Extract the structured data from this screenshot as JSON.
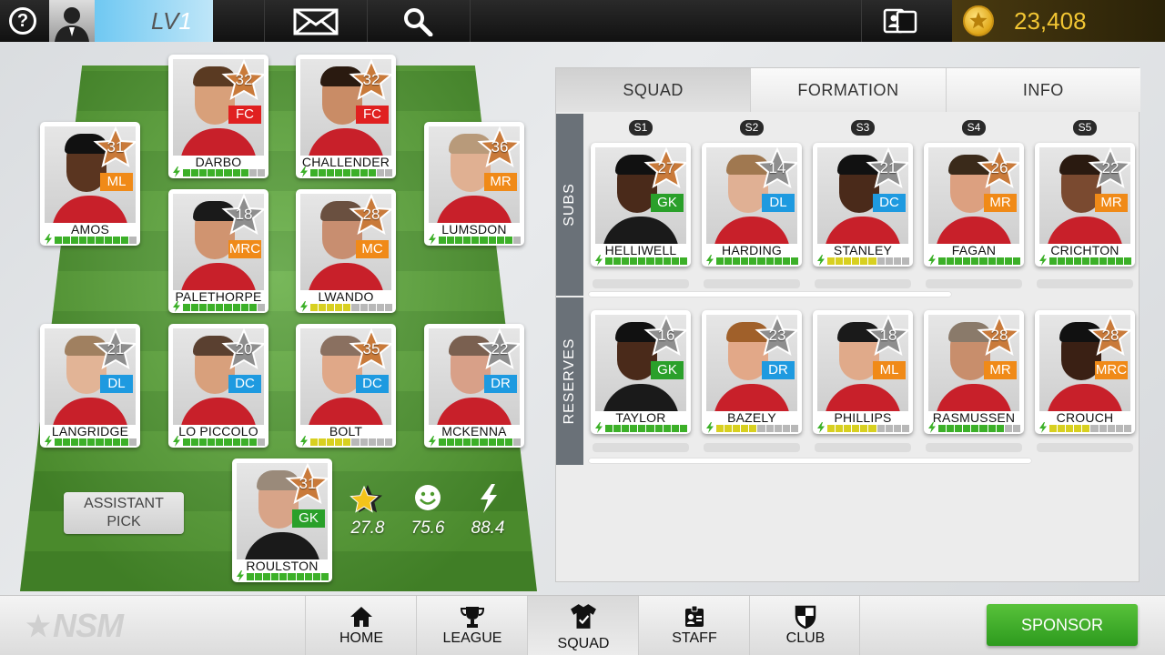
{
  "topbar": {
    "help_glyph": "?",
    "level_prefix": "LV",
    "level_value": "1",
    "coins": "23,408",
    "icons": [
      "help-icon",
      "manager-avatar",
      "mail-icon",
      "search-icon",
      "cards-icon",
      "coin-icon"
    ]
  },
  "colors": {
    "fc": "#e02020",
    "mid": "#f08a18",
    "def": "#1e9ae0",
    "gk": "#2aa02a",
    "star_bronze": "#c97a3a",
    "star_silver": "#8e8e8e",
    "stamina_green": "#3cb028",
    "stamina_yellow": "#d8d020"
  },
  "lineup": [
    {
      "name": "DARBO",
      "rating": "32",
      "pos": "FC",
      "pcls": "fc",
      "tier": "bronze",
      "skin": "#d8a07a",
      "hair": "#5a3a22",
      "stamina": 8,
      "scol": "green",
      "gk": false
    },
    {
      "name": "CHALLENDER",
      "rating": "32",
      "pos": "FC",
      "pcls": "fc",
      "tier": "bronze",
      "skin": "#c98c66",
      "hair": "#2a1a10",
      "stamina": 8,
      "scol": "green",
      "gk": false
    },
    {
      "name": "AMOS",
      "rating": "31",
      "pos": "ML",
      "pcls": "mid",
      "tier": "bronze",
      "skin": "#5a3520",
      "hair": "#111",
      "stamina": 9,
      "scol": "green",
      "gk": false
    },
    {
      "name": "LUMSDON",
      "rating": "36",
      "pos": "MR",
      "pcls": "mid",
      "tier": "bronze",
      "skin": "#e0b092",
      "hair": "#b89a7a",
      "stamina": 9,
      "scol": "green",
      "gk": false
    },
    {
      "name": "PALETHORPE",
      "rating": "18",
      "pos": "MRC",
      "pcls": "mid",
      "tier": "silver",
      "skin": "#d09470",
      "hair": "#1a1a1a",
      "stamina": 9,
      "scol": "green",
      "gk": false
    },
    {
      "name": "LWANDO",
      "rating": "28",
      "pos": "MC",
      "pcls": "mid",
      "tier": "bronze",
      "skin": "#c88e70",
      "hair": "#6a5040",
      "stamina": 5,
      "scol": "yellow",
      "gk": false
    },
    {
      "name": "LANGRIDGE",
      "rating": "21",
      "pos": "DL",
      "pcls": "def",
      "tier": "silver",
      "skin": "#e2b496",
      "hair": "#a08060",
      "stamina": 9,
      "scol": "green",
      "gk": false
    },
    {
      "name": "LO PICCOLO",
      "rating": "20",
      "pos": "DC",
      "pcls": "def",
      "tier": "silver",
      "skin": "#d8a07c",
      "hair": "#5a4030",
      "stamina": 9,
      "scol": "green",
      "gk": false
    },
    {
      "name": "BOLT",
      "rating": "35",
      "pos": "DC",
      "pcls": "def",
      "tier": "bronze",
      "skin": "#e0a888",
      "hair": "#8a7060",
      "stamina": 5,
      "scol": "yellow",
      "gk": false
    },
    {
      "name": "MCKENNA",
      "rating": "22",
      "pos": "DR",
      "pcls": "def",
      "tier": "silver",
      "skin": "#d8a088",
      "hair": "#7a6050",
      "stamina": 9,
      "scol": "green",
      "gk": false
    },
    {
      "name": "ROULSTON",
      "rating": "31",
      "pos": "GK",
      "pcls": "gk",
      "tier": "bronze",
      "skin": "#d8a488",
      "hair": "#9a8a7a",
      "stamina": 10,
      "scol": "green",
      "gk": true
    }
  ],
  "assistant_pick": {
    "line1": "ASSISTANT",
    "line2": "PICK"
  },
  "team_stats": [
    {
      "icon": "star-rating-icon",
      "value": "27.8"
    },
    {
      "icon": "morale-smile-icon",
      "value": "75.6"
    },
    {
      "icon": "energy-bolt-icon",
      "value": "88.4"
    }
  ],
  "panel": {
    "tabs": [
      "SQUAD",
      "FORMATION",
      "INFO"
    ],
    "active_tab": "SQUAD",
    "subs_label": "SUBS",
    "reserves_label": "RESERVES",
    "slot_tags": [
      "S1",
      "S2",
      "S3",
      "S4",
      "S5"
    ],
    "subs": [
      {
        "name": "HELLIWELL",
        "rating": "27",
        "pos": "GK",
        "pcls": "gk",
        "tier": "bronze",
        "skin": "#4a2a1a",
        "hair": "#111",
        "stamina": 10,
        "scol": "green",
        "gk": true
      },
      {
        "name": "HARDING",
        "rating": "14",
        "pos": "DL",
        "pcls": "def",
        "tier": "silver",
        "skin": "#e0b094",
        "hair": "#a07850",
        "stamina": 10,
        "scol": "green",
        "gk": false
      },
      {
        "name": "STANLEY",
        "rating": "21",
        "pos": "DC",
        "pcls": "def",
        "tier": "silver",
        "skin": "#4a2a1a",
        "hair": "#111",
        "stamina": 6,
        "scol": "yellow",
        "gk": false
      },
      {
        "name": "FAGAN",
        "rating": "26",
        "pos": "MR",
        "pcls": "mid",
        "tier": "bronze",
        "skin": "#dca080",
        "hair": "#3a2a1a",
        "stamina": 10,
        "scol": "green",
        "gk": false
      },
      {
        "name": "CRICHTON",
        "rating": "22",
        "pos": "MR",
        "pcls": "mid",
        "tier": "silver",
        "skin": "#7a4a30",
        "hair": "#2a1a10",
        "stamina": 10,
        "scol": "green",
        "gk": false
      }
    ],
    "reserves": [
      {
        "name": "TAYLOR",
        "rating": "16",
        "pos": "GK",
        "pcls": "gk",
        "tier": "silver",
        "skin": "#4a2a1a",
        "hair": "#111",
        "stamina": 10,
        "scol": "green",
        "gk": true
      },
      {
        "name": "BAZELY",
        "rating": "23",
        "pos": "DR",
        "pcls": "def",
        "tier": "silver",
        "skin": "#e2a888",
        "hair": "#a0602a",
        "stamina": 5,
        "scol": "yellow",
        "gk": false
      },
      {
        "name": "PHILLIPS",
        "rating": "18",
        "pos": "ML",
        "pcls": "mid",
        "tier": "silver",
        "skin": "#e0aa8a",
        "hair": "#1a1a1a",
        "stamina": 6,
        "scol": "yellow",
        "gk": false
      },
      {
        "name": "RASMUSSEN",
        "rating": "28",
        "pos": "MR",
        "pcls": "mid",
        "tier": "bronze",
        "skin": "#c88e6c",
        "hair": "#8a7a6a",
        "stamina": 8,
        "scol": "green",
        "gk": false
      },
      {
        "name": "CROUCH",
        "rating": "28",
        "pos": "MRC",
        "pcls": "mid",
        "tier": "bronze",
        "skin": "#3a2014",
        "hair": "#111",
        "stamina": 5,
        "scol": "yellow",
        "gk": false
      }
    ]
  },
  "bottombar": {
    "logo": "NSM",
    "nav": [
      {
        "label": "HOME",
        "icon": "home-icon"
      },
      {
        "label": "LEAGUE",
        "icon": "trophy-icon"
      },
      {
        "label": "SQUAD",
        "icon": "shirt-icon"
      },
      {
        "label": "STAFF",
        "icon": "staff-badge-icon"
      },
      {
        "label": "CLUB",
        "icon": "club-shield-icon"
      }
    ],
    "active_nav": "SQUAD",
    "sponsor": "SPONSOR"
  }
}
